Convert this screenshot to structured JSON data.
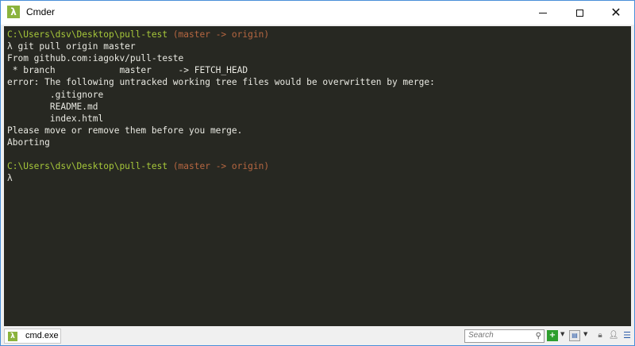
{
  "window": {
    "title": "Cmder",
    "app_icon": "λ"
  },
  "terminal": {
    "lines": [
      {
        "parts": [
          {
            "text": "C:\\Users\\dsv\\Desktop\\pull-test ",
            "class": "path"
          },
          {
            "text": "(master -> origin)",
            "class": "branch"
          }
        ]
      },
      {
        "parts": [
          {
            "text": "λ git pull origin master",
            "class": ""
          }
        ]
      },
      {
        "parts": [
          {
            "text": "From github.com:iagokv/pull-teste",
            "class": ""
          }
        ]
      },
      {
        "parts": [
          {
            "text": " * branch            master     -> FETCH_HEAD",
            "class": ""
          }
        ]
      },
      {
        "parts": [
          {
            "text": "error: The following untracked working tree files would be overwritten by merge:",
            "class": ""
          }
        ]
      },
      {
        "parts": [
          {
            "text": "        .gitignore",
            "class": ""
          }
        ]
      },
      {
        "parts": [
          {
            "text": "        README.md",
            "class": ""
          }
        ]
      },
      {
        "parts": [
          {
            "text": "        index.html",
            "class": ""
          }
        ]
      },
      {
        "parts": [
          {
            "text": "Please move or remove them before you merge.",
            "class": ""
          }
        ]
      },
      {
        "parts": [
          {
            "text": "Aborting",
            "class": ""
          }
        ]
      },
      {
        "parts": []
      },
      {
        "parts": [
          {
            "text": "C:\\Users\\dsv\\Desktop\\pull-test ",
            "class": "path"
          },
          {
            "text": "(master -> origin)",
            "class": "branch"
          }
        ]
      },
      {
        "parts": [
          {
            "text": "λ",
            "class": ""
          }
        ]
      }
    ]
  },
  "statusbar": {
    "tab_label": "cmd.exe",
    "tab_icon": "λ",
    "search_placeholder": "Search",
    "icons": [
      "search-icon",
      "add-console-icon",
      "dropdown-arrow-icon",
      "console-icon",
      "lock-icon",
      "user-icon",
      "menu-icon"
    ]
  },
  "colors": {
    "terminal_bg": "#272822",
    "terminal_text": "#e9e9e2",
    "path": "#a6c73a",
    "branch": "#b76741",
    "accent": "#8bb33c"
  }
}
